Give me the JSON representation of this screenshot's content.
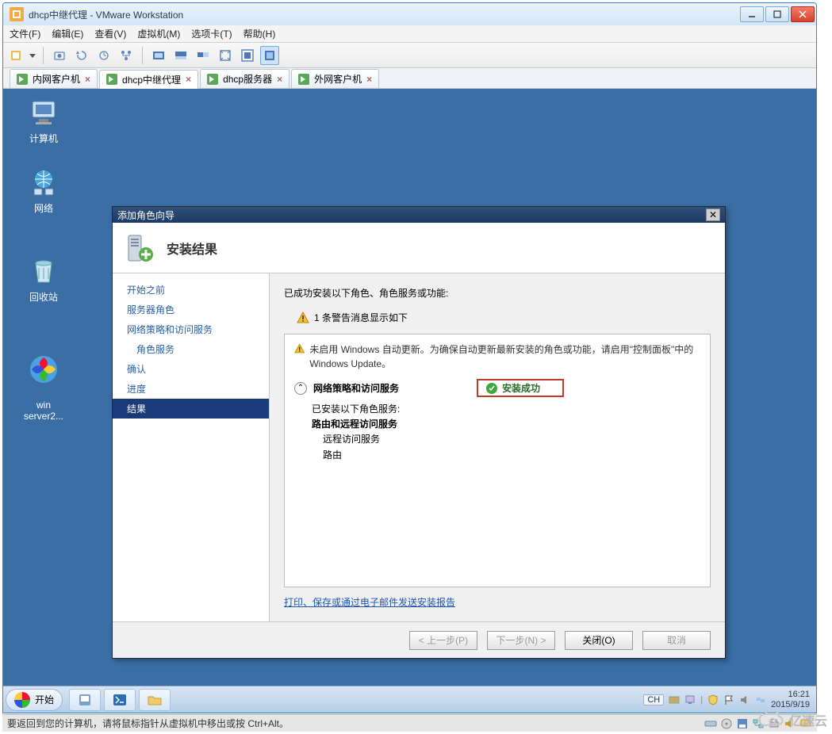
{
  "vmware": {
    "title": "dhcp中继代理 - VMware Workstation",
    "menu": [
      "文件(F)",
      "编辑(E)",
      "查看(V)",
      "虚拟机(M)",
      "选项卡(T)",
      "帮助(H)"
    ],
    "tabs": [
      {
        "label": "内网客户机",
        "active": false
      },
      {
        "label": "dhcp中继代理",
        "active": true
      },
      {
        "label": "dhcp服务器",
        "active": false
      },
      {
        "label": "外网客户机",
        "active": false
      }
    ],
    "status": "要返回到您的计算机，请将鼠标指针从虚拟机中移出或按 Ctrl+Alt。"
  },
  "desktop_icons": [
    {
      "name": "computer",
      "label": "计算机"
    },
    {
      "name": "network",
      "label": "网络"
    },
    {
      "name": "recycle",
      "label": "回收站"
    },
    {
      "name": "winserver",
      "label": "win\nserver2..."
    }
  ],
  "wizard": {
    "window_title": "添加角色向导",
    "header": "安装结果",
    "steps": [
      {
        "label": "开始之前",
        "indent": false,
        "sel": false
      },
      {
        "label": "服务器角色",
        "indent": false,
        "sel": false
      },
      {
        "label": "网络策略和访问服务",
        "indent": false,
        "sel": false
      },
      {
        "label": "角色服务",
        "indent": true,
        "sel": false
      },
      {
        "label": "确认",
        "indent": false,
        "sel": false
      },
      {
        "label": "进度",
        "indent": false,
        "sel": false
      },
      {
        "label": "结果",
        "indent": false,
        "sel": true
      }
    ],
    "lead": "已成功安装以下角色、角色服务或功能:",
    "warn_count": "1 条警告消息显示如下",
    "notice": "未启用 Windows 自动更新。为确保自动更新最新安装的角色或功能，请启用\"控制面板\"中的 Windows Update。",
    "section_title": "网络策略和访问服务",
    "success_badge": "安装成功",
    "installed_label": "已安装以下角色服务:",
    "installed_bold": "路由和远程访问服务",
    "installed_items": [
      "远程访问服务",
      "路由"
    ],
    "report_link": "打印、保存或通过电子邮件发送安装报告",
    "buttons": {
      "prev": "< 上一步(P)",
      "next": "下一步(N) >",
      "close": "关闭(O)",
      "cancel": "取消"
    }
  },
  "guest_taskbar": {
    "start": "开始",
    "lang": "CH",
    "time": "16:21",
    "date": "2015/9/19"
  },
  "watermark": "亿速云"
}
